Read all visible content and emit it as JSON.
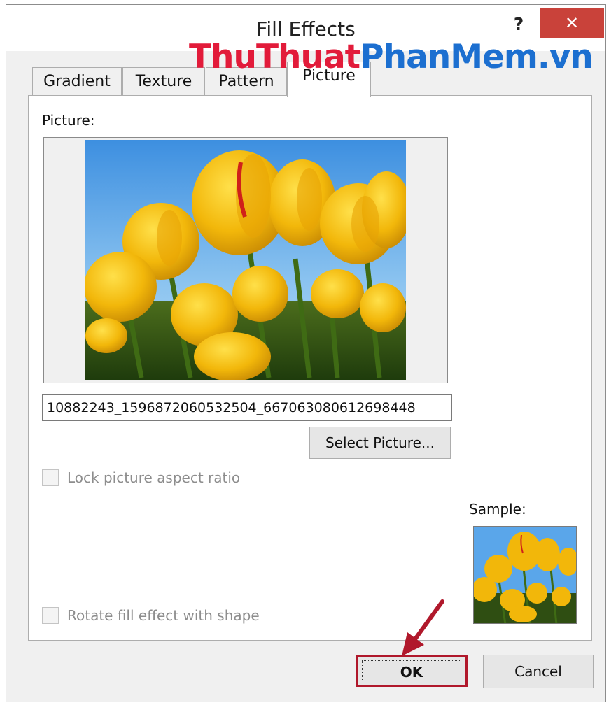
{
  "window": {
    "title": "Fill Effects",
    "help_label": "?",
    "close_label": "✕"
  },
  "watermark": {
    "part1": "ThuThuat",
    "part2": "PhanMem.vn"
  },
  "tabs": [
    {
      "label": "Gradient"
    },
    {
      "label": "Texture"
    },
    {
      "label": "Pattern"
    },
    {
      "label": "Picture",
      "active": true
    }
  ],
  "picture_section": {
    "label": "Picture:",
    "filename": "10882243_1596872060532504_667063080612698448",
    "select_button": "Select Picture..."
  },
  "options": {
    "lock_aspect": {
      "label": "Lock picture aspect ratio",
      "checked": false,
      "enabled": false
    },
    "rotate_fill": {
      "label": "Rotate fill effect with shape",
      "checked": false,
      "enabled": false
    }
  },
  "sample": {
    "label": "Sample:"
  },
  "buttons": {
    "ok": "OK",
    "cancel": "Cancel"
  },
  "colors": {
    "close_red": "#c9423a",
    "highlight_red": "#b0182b",
    "watermark_red": "#e21b3a",
    "watermark_blue": "#1c6fd0"
  }
}
